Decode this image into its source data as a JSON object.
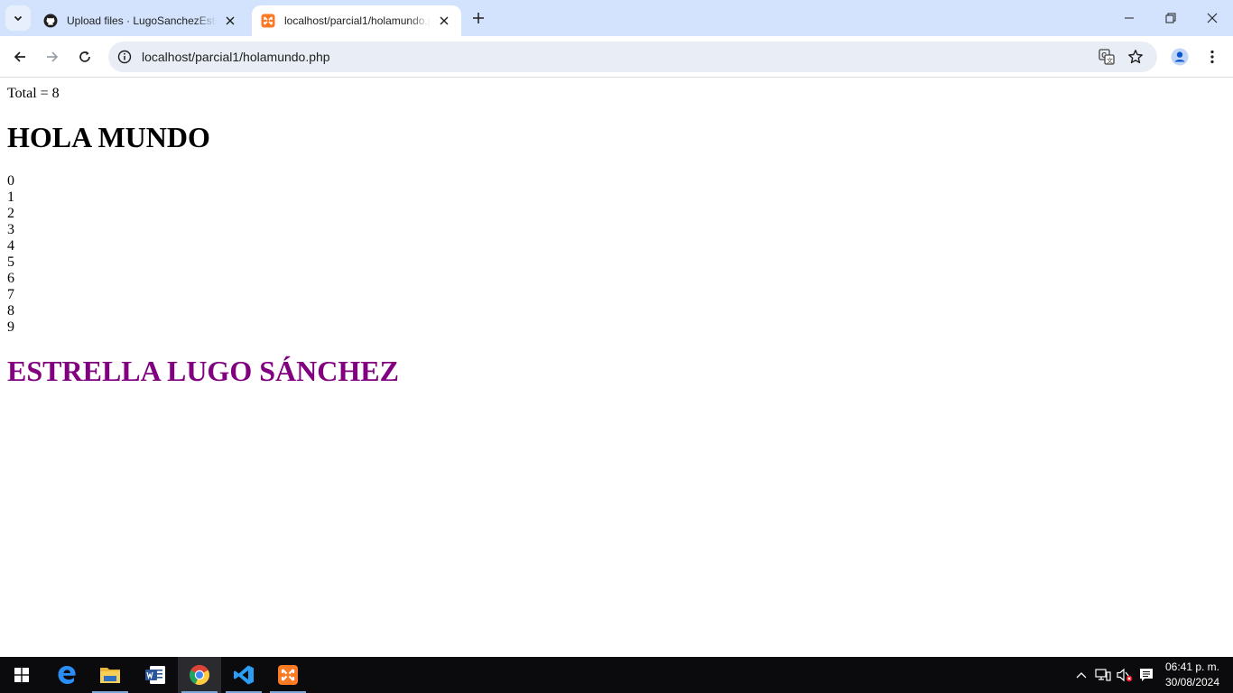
{
  "browser": {
    "tabs": [
      {
        "title": "Upload files · LugoSanchezEstrella",
        "favicon": "github-icon",
        "active": false
      },
      {
        "title": "localhost/parcial1/holamundo.php",
        "favicon": "xampp-icon",
        "active": true
      }
    ],
    "address_bar": {
      "url": "localhost/parcial1/holamundo.php"
    }
  },
  "page": {
    "total_text": "Total = 8",
    "heading": "HOLA MUNDO",
    "numbers": [
      "0",
      "1",
      "2",
      "3",
      "4",
      "5",
      "6",
      "7",
      "8",
      "9"
    ],
    "name_heading": "ESTRELLA LUGO SÁNCHEZ",
    "name_color": "#800080"
  },
  "taskbar": {
    "apps": [
      "start-icon",
      "edge-icon",
      "file-explorer-icon",
      "word-icon",
      "chrome-icon",
      "vscode-icon",
      "xampp-icon"
    ],
    "clock": {
      "time": "06:41 p. m.",
      "date": "30/08/2024"
    }
  },
  "colors": {
    "tabstrip": "#d3e3fd",
    "omnibox": "#e9eef6",
    "taskbar": "#0b0b0d"
  }
}
